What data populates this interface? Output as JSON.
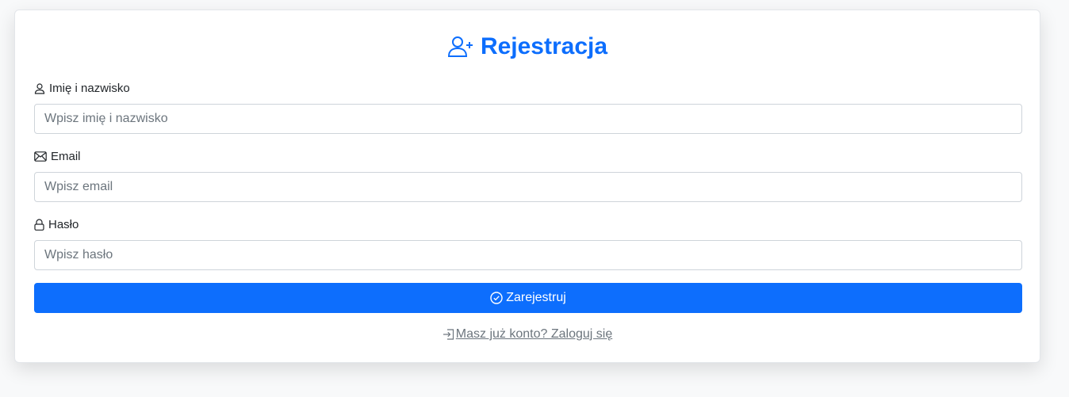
{
  "form": {
    "title": "Rejestracja",
    "title_icon": "person-plus-icon",
    "accent_color": "#0d6efd",
    "fields": [
      {
        "label": "Imię i nazwisko",
        "icon": "person-icon",
        "placeholder": "Wpisz imię i nazwisko",
        "value": ""
      },
      {
        "label": "Email",
        "icon": "envelope-icon",
        "placeholder": "Wpisz email",
        "value": ""
      },
      {
        "label": "Hasło",
        "icon": "lock-icon",
        "placeholder": "Wpisz hasło",
        "value": ""
      }
    ],
    "submit_label": "Zarejestruj",
    "submit_icon": "check-circle-icon",
    "login_link_label": "Masz już konto? Zaloguj się",
    "login_link_icon": "box-arrow-in-right-icon"
  }
}
